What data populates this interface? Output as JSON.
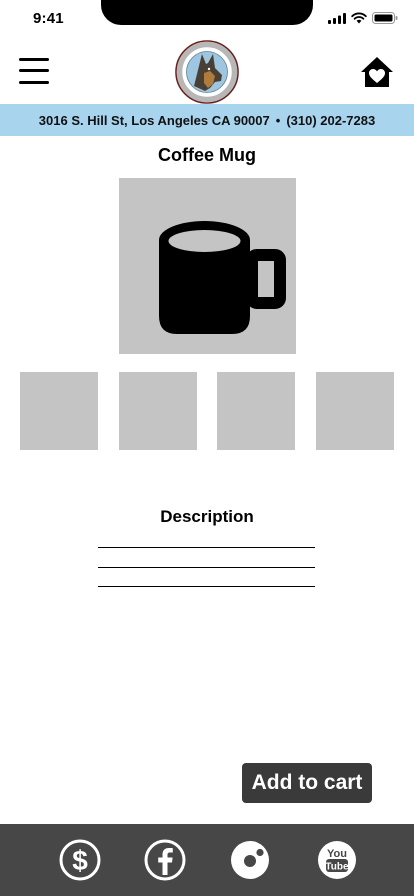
{
  "status_bar": {
    "time": "9:41",
    "icons": [
      "signal-icon",
      "wifi-icon",
      "battery-icon"
    ]
  },
  "header": {
    "menu_icon": "hamburger-icon",
    "logo_icon": "german-shepherd-logo",
    "home_icon": "home-heart-icon"
  },
  "address": {
    "street": "3016 S. Hill St, Los Angeles CA 90007",
    "separator": "•",
    "phone": "(310) 202-7283"
  },
  "product": {
    "title": "Coffee Mug",
    "image_icon": "mug-icon",
    "thumbnail_count": 4
  },
  "description": {
    "title": "Description"
  },
  "actions": {
    "add_to_cart": "Add to cart"
  },
  "footer": {
    "icons": [
      "dollar-icon",
      "facebook-icon",
      "donut-icon",
      "youtube-icon"
    ],
    "youtube_text": [
      "You",
      "Tube"
    ]
  },
  "colors": {
    "address_band": "#a8d4ee",
    "placeholder_gray": "#c4c4c4",
    "footer_bg": "#474747",
    "button_bg": "#3a3a3a"
  }
}
